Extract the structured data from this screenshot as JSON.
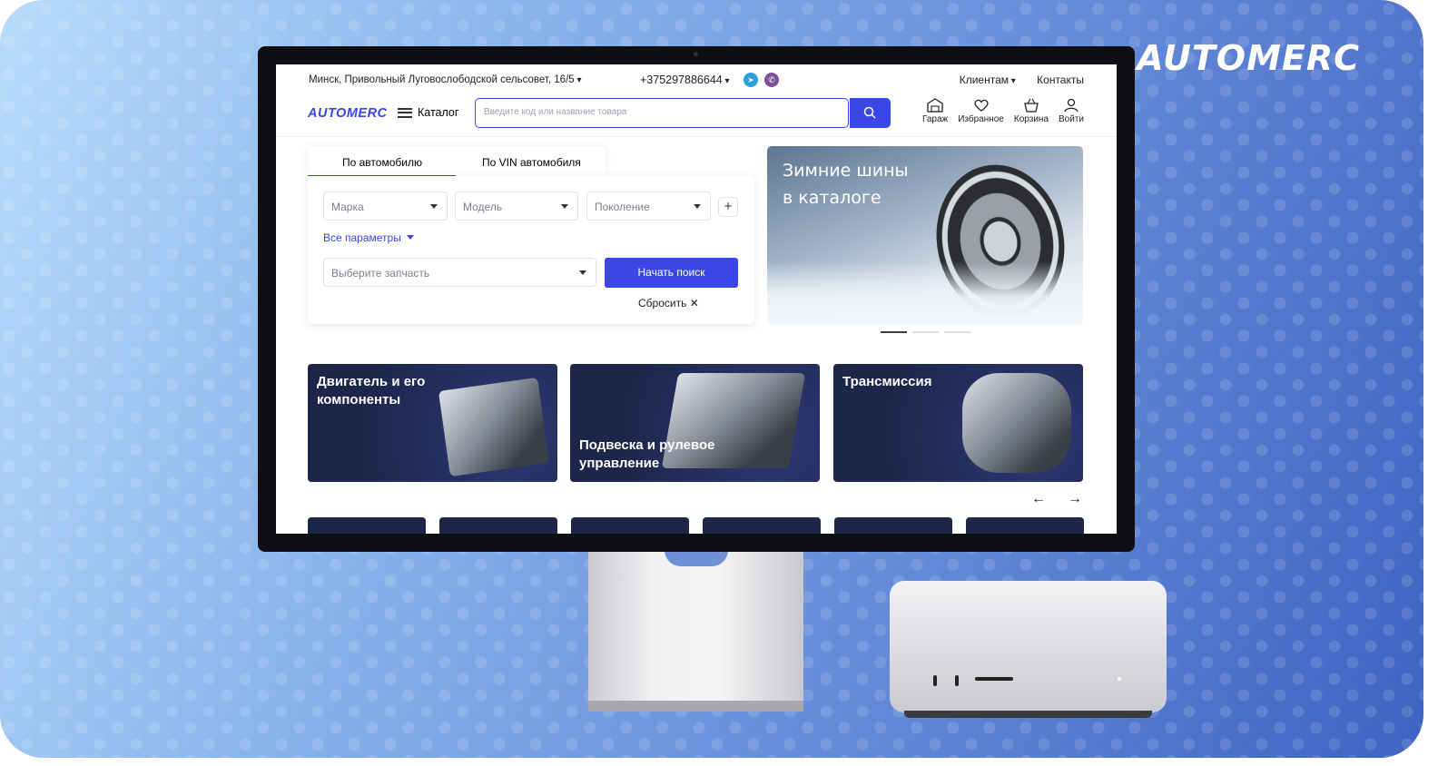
{
  "brand": "AUTOMERC",
  "topbar": {
    "address": "Минск, Привольный Луговослободской сельсовет, 16/5",
    "phone": "+375297886644",
    "clients": "Клиентам",
    "contacts": "Контакты"
  },
  "header": {
    "logo": "AUTOMERC",
    "catalog": "Каталог",
    "search_placeholder": "Введите код или название товара",
    "icons": [
      {
        "name": "garage-icon",
        "label": "Гараж"
      },
      {
        "name": "heart-icon",
        "label": "Избранное"
      },
      {
        "name": "basket-icon",
        "label": "Корзина"
      },
      {
        "name": "user-icon",
        "label": "Войти"
      }
    ]
  },
  "search_panel": {
    "tabs": [
      "По автомобилю",
      "По VIN автомобиля"
    ],
    "brand": "Марка",
    "model": "Модель",
    "generation": "Поколение",
    "all_params": "Все параметры",
    "part": "Выберите запчасть",
    "start": "Начать поиск",
    "reset": "Сбросить"
  },
  "banner": {
    "line1": "Зимние шины",
    "line2": "в каталоге"
  },
  "categories": [
    "Двигатель и его компоненты",
    "Подвеска и рулевое управление",
    "Трансмиссия"
  ],
  "colors": {
    "accent": "#3a47e6",
    "card_bg": "#1d2548"
  }
}
